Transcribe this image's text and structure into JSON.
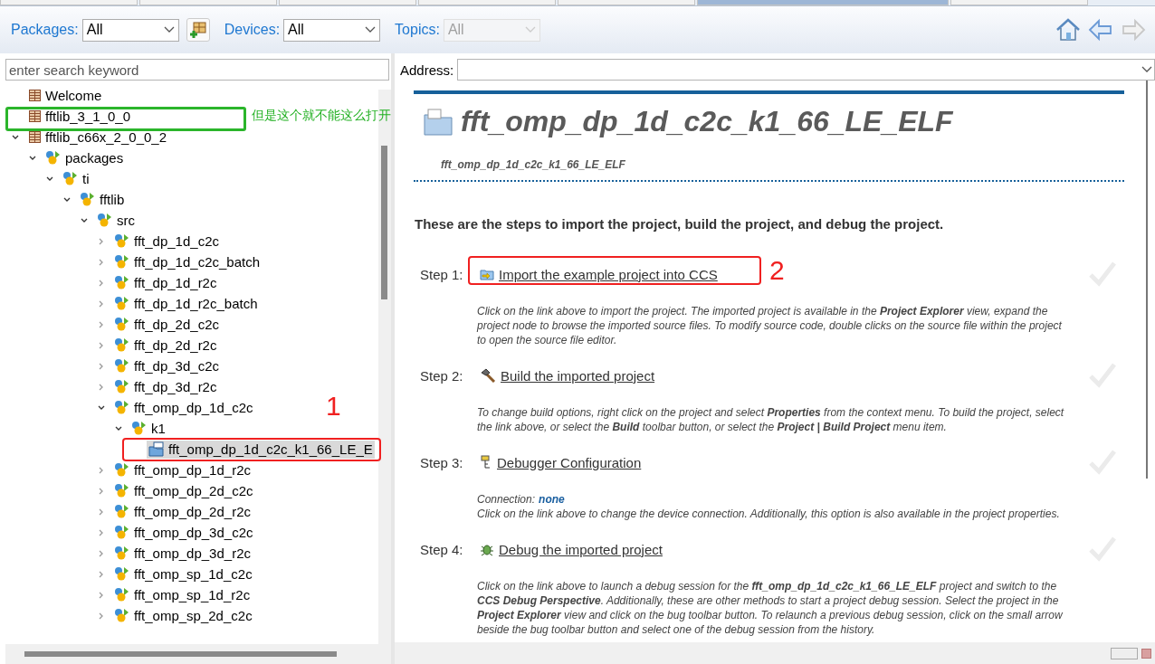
{
  "editor_tabs": [
    {
      "selected": false
    },
    {
      "selected": false
    },
    {
      "selected": false
    },
    {
      "selected": false
    },
    {
      "selected": false
    },
    {
      "selected": true
    },
    {
      "selected": false
    }
  ],
  "filters": [
    {
      "label": "Packages:",
      "value": "All",
      "disabled": false
    },
    {
      "label": "Devices:",
      "value": "All",
      "disabled": false
    },
    {
      "label": "Topics:",
      "value": "All",
      "disabled": true
    }
  ],
  "nav": [
    {
      "kind": "home",
      "disabled": false
    },
    {
      "kind": "back",
      "disabled": false
    },
    {
      "kind": "forward",
      "disabled": true
    }
  ],
  "search": {
    "placeholder": "enter search keyword"
  },
  "tree": [
    {
      "label": "Welcome",
      "kind": "package",
      "selected": false
    },
    {
      "label": "fftlib_3_1_0_0",
      "kind": "package",
      "selected": false
    },
    {
      "label": "fftlib_c66x_2_0_0_2",
      "kind": "package",
      "selected": false,
      "expanded": true,
      "children": [
        {
          "label": "packages",
          "kind": "folder",
          "selected": false,
          "expanded": true,
          "children": [
            {
              "label": "ti",
              "kind": "folder",
              "selected": false,
              "expanded": true,
              "children": [
                {
                  "label": "fftlib",
                  "kind": "folder",
                  "selected": false,
                  "expanded": true,
                  "children": [
                    {
                      "label": "src",
                      "kind": "folder",
                      "selected": false,
                      "expanded": true,
                      "children": [
                        {
                          "label": "fft_dp_1d_c2c",
                          "kind": "folder",
                          "selected": false,
                          "expanded": false
                        },
                        {
                          "label": "fft_dp_1d_c2c_batch",
                          "kind": "folder",
                          "selected": false,
                          "expanded": false
                        },
                        {
                          "label": "fft_dp_1d_r2c",
                          "kind": "folder",
                          "selected": false,
                          "expanded": false
                        },
                        {
                          "label": "fft_dp_1d_r2c_batch",
                          "kind": "folder",
                          "selected": false,
                          "expanded": false
                        },
                        {
                          "label": "fft_dp_2d_c2c",
                          "kind": "folder",
                          "selected": false,
                          "expanded": false
                        },
                        {
                          "label": "fft_dp_2d_r2c",
                          "kind": "folder",
                          "selected": false,
                          "expanded": false
                        },
                        {
                          "label": "fft_dp_3d_c2c",
                          "kind": "folder",
                          "selected": false,
                          "expanded": false
                        },
                        {
                          "label": "fft_dp_3d_r2c",
                          "kind": "folder",
                          "selected": false,
                          "expanded": false
                        },
                        {
                          "label": "fft_omp_dp_1d_c2c",
                          "kind": "folder",
                          "selected": false,
                          "expanded": true,
                          "children": [
                            {
                              "label": "k1",
                              "kind": "folder",
                              "selected": false,
                              "expanded": true,
                              "children": [
                                {
                                  "label": "fft_omp_dp_1d_c2c_k1_66_LE_E",
                                  "kind": "project",
                                  "selected": true
                                }
                              ]
                            }
                          ]
                        },
                        {
                          "label": "fft_omp_dp_1d_r2c",
                          "kind": "folder",
                          "selected": false,
                          "expanded": false
                        },
                        {
                          "label": "fft_omp_dp_2d_c2c",
                          "kind": "folder",
                          "selected": false,
                          "expanded": false
                        },
                        {
                          "label": "fft_omp_dp_2d_r2c",
                          "kind": "folder",
                          "selected": false,
                          "expanded": false
                        },
                        {
                          "label": "fft_omp_dp_3d_c2c",
                          "kind": "folder",
                          "selected": false,
                          "expanded": false
                        },
                        {
                          "label": "fft_omp_dp_3d_r2c",
                          "kind": "folder",
                          "selected": false,
                          "expanded": false
                        },
                        {
                          "label": "fft_omp_sp_1d_c2c",
                          "kind": "folder",
                          "selected": false,
                          "expanded": false
                        },
                        {
                          "label": "fft_omp_sp_1d_r2c",
                          "kind": "folder",
                          "selected": false,
                          "expanded": false
                        },
                        {
                          "label": "fft_omp_sp_2d_c2c",
                          "kind": "folder",
                          "selected": false,
                          "expanded": false
                        }
                      ]
                    }
                  ]
                }
              ]
            }
          ]
        }
      ]
    }
  ],
  "address": {
    "label": "Address:"
  },
  "page": {
    "title": "fft_omp_dp_1d_c2c_k1_66_LE_ELF",
    "subtitle": "fft_omp_dp_1d_c2c_k1_66_LE_ELF",
    "intro": "These are the steps to import the project, build the project, and debug the project.",
    "steps": [
      {
        "label": "Step 1:",
        "kind": "import",
        "link": "Import the example project into CCS",
        "description": "Click on the link above to import the project. The imported project is available in the **Project Explorer** view, expand the project node to browse the imported source files. To modify source code, double clicks on the source file within the project to open the source file editor."
      },
      {
        "label": "Step 2:",
        "kind": "build",
        "link": "Build the imported project",
        "description": "To change build options, right click on the project and select **Properties** from the context menu. To build the project, select the link above, or select the **Build** toolbar button, or select the **Project | Build Project** menu item."
      },
      {
        "label": "Step 3:",
        "kind": "config",
        "link": "Debugger Configuration",
        "connection": {
          "label": "Connection:",
          "value": "none"
        },
        "description": "Click on the link above to change the device connection. Additionally, this option is also available in the project properties."
      },
      {
        "label": "Step 4:",
        "kind": "debug",
        "link": "Debug the imported project",
        "description": "Click on the link above to launch a debug session for the **fft_omp_dp_1d_c2c_k1_66_LE_ELF** project and switch to the **CCS Debug Perspective**. Additionally, these are other methods to start a project debug session. Select the project in the **Project Explorer** view and click on the bug toolbar button. To relaunch a previous debug session, click on the small arrow beside the bug toolbar button and select one of the debug session from the history."
      }
    ]
  },
  "annotations": [
    {
      "kind": "green-box",
      "text": "但是这个就不能这么打开"
    },
    {
      "kind": "red-box",
      "text": "1"
    },
    {
      "kind": "red-box",
      "text": "2"
    }
  ]
}
